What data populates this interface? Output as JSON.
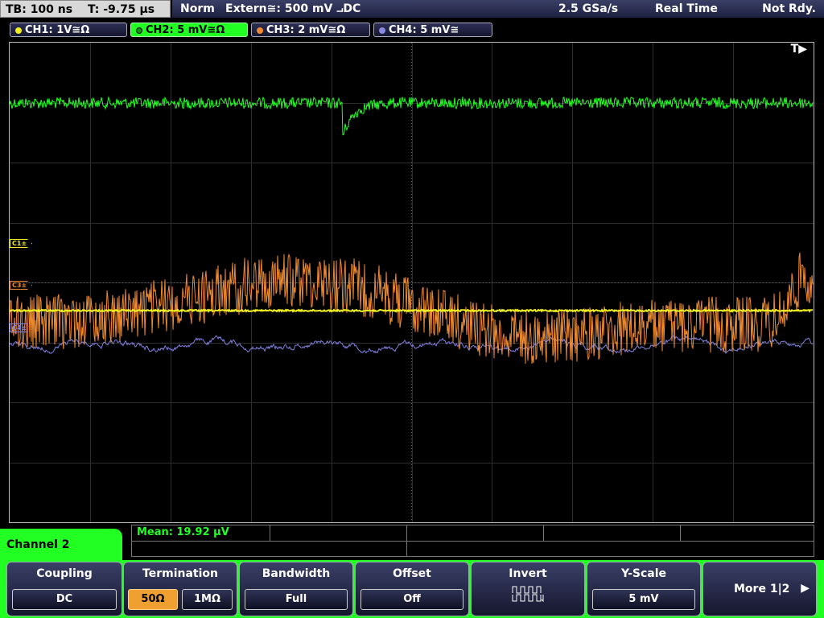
{
  "status": {
    "timebase": "TB: 100 ns",
    "trigger_time": "T: -9.75 µs",
    "mode": "Norm",
    "trigger_source": "Extern≅: 500 mV ⨼DC",
    "sample_rate": "2.5 GSa/s",
    "acquisition": "Real Time",
    "state": "Not Rdy."
  },
  "channels": [
    {
      "label": "CH1: 1V≅Ω",
      "color": "#f0f020",
      "active": false
    },
    {
      "label": "CH2: 5 mV≅Ω",
      "color": "#22ff22",
      "active": true
    },
    {
      "label": "CH3: 2 mV≅Ω",
      "color": "#f08a30",
      "active": false
    },
    {
      "label": "CH4: 5 mV≅",
      "color": "#8888dd",
      "active": false
    }
  ],
  "markers": {
    "trigger": "T▶",
    "ch1": "C1±",
    "ch3": "C3±",
    "ch4": "C4±"
  },
  "measurement": {
    "label": "Mean: 19.92 µV"
  },
  "menu": {
    "title": "Channel 2",
    "softkeys": {
      "coupling": {
        "title": "Coupling",
        "value": "DC"
      },
      "termination": {
        "title": "Termination",
        "options": [
          "50Ω",
          "1MΩ"
        ],
        "selected": "50Ω"
      },
      "bandwidth": {
        "title": "Bandwidth",
        "value": "Full"
      },
      "offset": {
        "title": "Offset",
        "value": "Off"
      },
      "invert": {
        "title": "Invert",
        "icon": "square-wave-invert-icon"
      },
      "yscale": {
        "title": "Y-Scale",
        "value": "5 mV"
      },
      "more": {
        "label": "More 1|2"
      }
    }
  },
  "colors": {
    "ch1": "#f0f020",
    "ch2": "#22ff22",
    "ch3": "#f08a30",
    "ch4": "#8080e0",
    "accent_select": "#f0a030"
  }
}
